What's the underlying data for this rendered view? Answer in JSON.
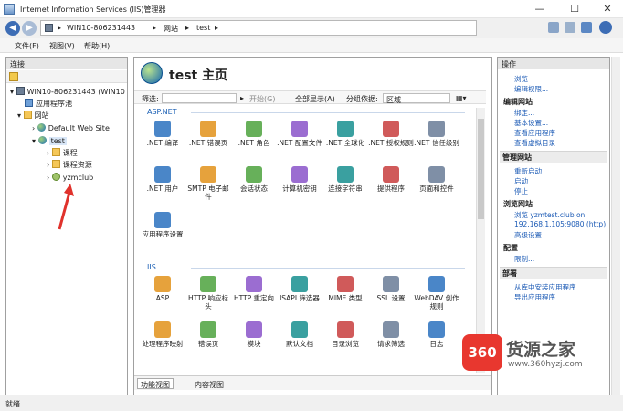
{
  "window": {
    "title": "Internet Information Services (IIS)管理器",
    "minimize": "—",
    "maximize": "☐",
    "close": "✕"
  },
  "address": {
    "crumbs": [
      "WIN10-806231443",
      "网站",
      "test"
    ],
    "sep": "▸"
  },
  "menu": [
    "文件(F)",
    "视图(V)",
    "帮助(H)"
  ],
  "connections": {
    "header": "连接",
    "tree": [
      {
        "label": "WIN10-806231443 (WIN10",
        "icon": "server",
        "level": 0
      },
      {
        "label": "应用程序池",
        "icon": "pool",
        "level": 1
      },
      {
        "label": "网站",
        "icon": "folder",
        "level": 1
      },
      {
        "label": "Default Web Site",
        "icon": "globe",
        "level": 2
      },
      {
        "label": "test",
        "icon": "globe",
        "level": 2
      },
      {
        "label": "课程",
        "icon": "folder",
        "level": 3
      },
      {
        "label": "课程资源",
        "icon": "folder",
        "level": 3
      },
      {
        "label": "yzmclub",
        "icon": "app",
        "level": 3
      }
    ]
  },
  "main": {
    "title": "test 主页",
    "filter": {
      "label": "筛选:",
      "start": "开始(G)",
      "showall": "全部显示(A)",
      "groupby": "分组依据:",
      "groupval": "区域"
    },
    "sections": [
      {
        "name": "ASP.NET",
        "items": [
          ".NET 编译",
          ".NET 错误页",
          ".NET 角色",
          ".NET 配置文件",
          ".NET 全球化",
          ".NET 授权规则",
          ".NET 信任级别",
          ".NET 用户",
          "SMTP 电子邮件",
          "会话状态",
          "计算机密钥",
          "连接字符串",
          "提供程序",
          "页面和控件",
          "应用程序设置"
        ]
      },
      {
        "name": "IIS",
        "items": [
          "ASP",
          "HTTP 响应标头",
          "HTTP 重定向",
          "ISAPI 筛选器",
          "MIME 类型",
          "SSL 设置",
          "WebDAV 创作规则",
          "处理程序映射",
          "错误页",
          "模块",
          "默认文档",
          "目录浏览",
          "请求筛选",
          "日志"
        ]
      }
    ],
    "tabs": [
      "功能视图",
      "内容视图"
    ]
  },
  "actions": {
    "header": "操作",
    "items": [
      {
        "t": "link",
        "label": "浏览"
      },
      {
        "t": "link",
        "label": "编辑权限..."
      },
      {
        "t": "head",
        "label": "编辑网站"
      },
      {
        "t": "link",
        "label": "绑定..."
      },
      {
        "t": "link",
        "label": "基本设置..."
      },
      {
        "t": "link",
        "label": "查看应用程序"
      },
      {
        "t": "link",
        "label": "查看虚拟目录"
      },
      {
        "t": "group",
        "label": "管理网站"
      },
      {
        "t": "link",
        "label": "重新启动"
      },
      {
        "t": "link",
        "label": "启动"
      },
      {
        "t": "link",
        "label": "停止"
      },
      {
        "t": "head",
        "label": "浏览网站"
      },
      {
        "t": "link",
        "label": "浏览 yzmtest.club on"
      },
      {
        "t": "link",
        "label": "192.168.1.105:9080 (http)"
      },
      {
        "t": "link",
        "label": "高级设置..."
      },
      {
        "t": "head",
        "label": "配置"
      },
      {
        "t": "link",
        "label": "限制..."
      },
      {
        "t": "group",
        "label": "部署"
      },
      {
        "t": "link",
        "label": "从库中安装应用程序"
      },
      {
        "t": "link",
        "label": "导出应用程序"
      }
    ]
  },
  "status": "就绪",
  "watermark": {
    "logo": "360",
    "brand": "货源之家",
    "url": "www.360hyzj.com"
  },
  "colors": {
    "accent": "#1a5fb4",
    "arrow": "#e0322c"
  }
}
